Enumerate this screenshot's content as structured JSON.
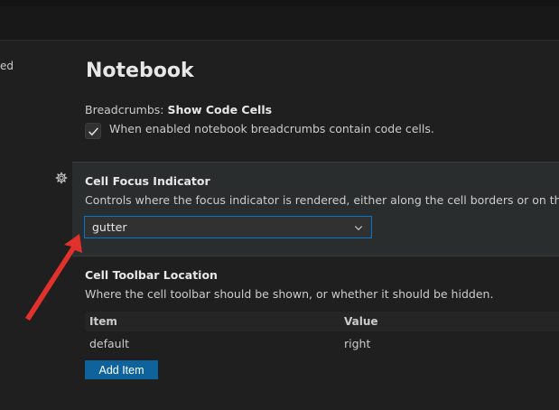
{
  "left": {
    "clipped_text": "ed"
  },
  "section": {
    "title": "Notebook"
  },
  "breadcrumbs": {
    "category": "Breadcrumbs: ",
    "name": "Show Code Cells",
    "checkbox_checked": true,
    "checkbox_text": "When enabled notebook breadcrumbs contain code cells."
  },
  "cell_focus": {
    "title": "Cell Focus Indicator",
    "description": "Controls where the focus indicator is rendered, either along the cell borders or on the left gu",
    "selected_value": "gutter"
  },
  "cell_toolbar": {
    "title": "Cell Toolbar Location",
    "description": "Where the cell toolbar should be shown, or whether it should be hidden.",
    "columns": [
      "Item",
      "Value"
    ],
    "rows": [
      {
        "item": "default",
        "value": "right"
      }
    ],
    "add_button": "Add Item"
  },
  "colors": {
    "accent_border": "#0078d4",
    "button_bg": "#0e639c",
    "arrow": "#e0312c"
  },
  "icons": {
    "gear": "gear-icon",
    "check": "check-icon",
    "chevron": "chevron-down-icon",
    "arrow": "arrow-annotation"
  }
}
